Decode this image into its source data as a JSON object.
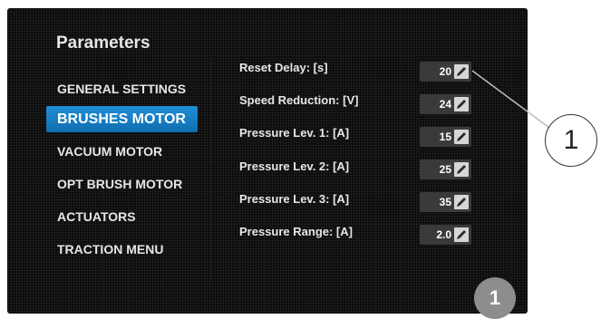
{
  "panel": {
    "title": "Parameters"
  },
  "menu": [
    {
      "label": "GENERAL SETTINGS",
      "active": false
    },
    {
      "label": "BRUSHES MOTOR",
      "active": true
    },
    {
      "label": "VACUUM MOTOR",
      "active": false
    },
    {
      "label": "OPT BRUSH MOTOR",
      "active": false
    },
    {
      "label": "ACTUATORS",
      "active": false
    },
    {
      "label": "TRACTION MENU",
      "active": false
    }
  ],
  "params": [
    {
      "label": "Reset Delay: [s]",
      "value": "20"
    },
    {
      "label": "Speed Reduction: [V]",
      "value": "24"
    },
    {
      "label": "Pressure Lev. 1: [A]",
      "value": "15"
    },
    {
      "label": "Pressure Lev. 2: [A]",
      "value": "25"
    },
    {
      "label": "Pressure Lev. 3: [A]",
      "value": "35"
    },
    {
      "label": "Pressure Range: [A]",
      "value": "2.0"
    }
  ],
  "callout": {
    "label": "1"
  },
  "badge": {
    "label": "1"
  },
  "colors": {
    "accent": "#1a86cf",
    "screen": "#0d0d0d",
    "value_box": "#3a3a3a"
  },
  "icons": {
    "edit": "pencil-icon"
  }
}
